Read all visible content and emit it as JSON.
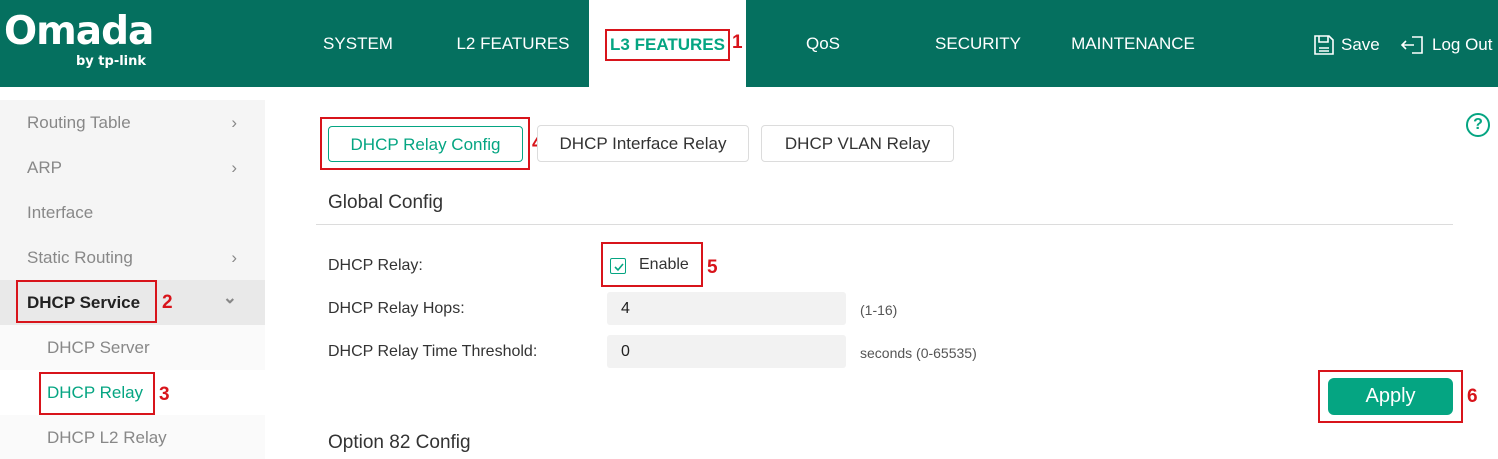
{
  "brand": {
    "name": "Omada",
    "sub": "by tp-link"
  },
  "nav": {
    "items": [
      {
        "label": "SYSTEM"
      },
      {
        "label": "L2 FEATURES"
      },
      {
        "label": "L3 FEATURES",
        "active": true
      },
      {
        "label": "QoS"
      },
      {
        "label": "SECURITY"
      },
      {
        "label": "MAINTENANCE"
      }
    ],
    "save_label": "Save",
    "logout_label": "Log Out"
  },
  "sidebar": {
    "items": [
      {
        "label": "Routing Table",
        "chevron": "›"
      },
      {
        "label": "ARP",
        "chevron": "›"
      },
      {
        "label": "Interface"
      },
      {
        "label": "Static Routing",
        "chevron": "›"
      },
      {
        "label": "DHCP Service",
        "chevron": "⌄",
        "expanded": true
      },
      {
        "label": "DHCP Server"
      },
      {
        "label": "DHCP Relay",
        "selected": true
      },
      {
        "label": "DHCP L2 Relay"
      }
    ]
  },
  "tabs": [
    {
      "label": "DHCP Relay Config",
      "active": true
    },
    {
      "label": "DHCP Interface Relay"
    },
    {
      "label": "DHCP VLAN Relay"
    }
  ],
  "global_config": {
    "title": "Global Config",
    "dhcp_relay_label": "DHCP Relay:",
    "enable_label": "Enable",
    "enable_checked": true,
    "hops_label": "DHCP Relay Hops:",
    "hops_value": "4",
    "hops_hint": "(1-16)",
    "threshold_label": "DHCP Relay Time Threshold:",
    "threshold_value": "0",
    "threshold_hint": "seconds (0-65535)",
    "apply_label": "Apply"
  },
  "option82": {
    "title": "Option 82 Config"
  },
  "annotations": [
    "1",
    "2",
    "3",
    "4",
    "5",
    "6"
  ],
  "colors": {
    "header": "#05705f",
    "accent": "#05a582",
    "annotation": "#d8141b"
  },
  "icons": {
    "help": "?",
    "save": "save-icon",
    "logout": "logout-icon",
    "check": "check-icon"
  }
}
